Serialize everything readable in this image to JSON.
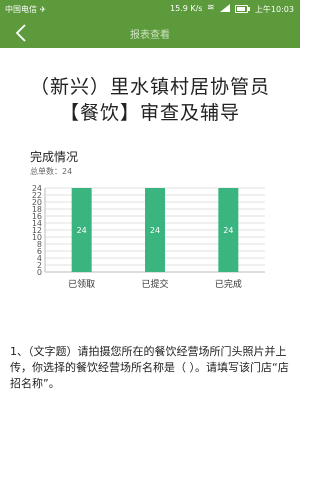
{
  "status_bar": {
    "carrier": "中国电信 ✈",
    "net_speed": "15.9 K/s",
    "clock": "上午10:03"
  },
  "header": {
    "title": "报表查看",
    "back_icon": "chevron-left-icon"
  },
  "page": {
    "title_line1": "（新兴）里水镇村居协管员",
    "title_line2": "【餐饮】审查及辅导"
  },
  "colors": {
    "brand": "#5c9a3c",
    "bar": "#3bb57f"
  },
  "chart_data": {
    "type": "bar",
    "title": "完成情况",
    "subtitle": "总单数：24",
    "categories": [
      "已领取",
      "已提交",
      "已完成"
    ],
    "values": [
      24,
      24,
      24
    ],
    "ylim": [
      0,
      24
    ],
    "yticks": [
      0,
      2,
      4,
      6,
      8,
      10,
      12,
      14,
      16,
      18,
      20,
      22,
      24
    ],
    "grid": true,
    "data_labels": true
  },
  "question": {
    "text": "1、（文字题）请拍摄您所在的餐饮经营场所门头照片并上传，你选择的餐饮经营场所名称是（ ）。请填写该门店“店招名称”。"
  }
}
